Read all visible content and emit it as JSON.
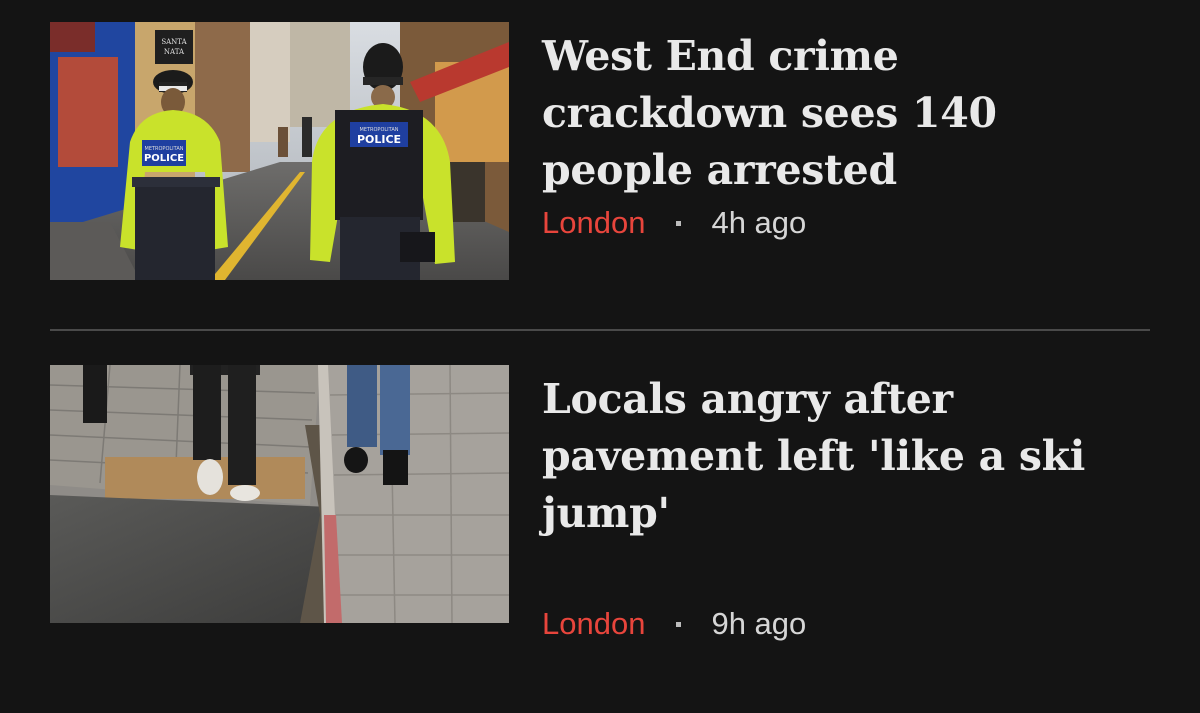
{
  "feed": {
    "stories": [
      {
        "headline": "West End crime crackdown sees 140 people arrested",
        "topic": "London",
        "time": "4h ago",
        "image_text": {
          "shop_sign_line1": "SANTA",
          "shop_sign_line2": "NATA",
          "vest_line1": "METROPOLITAN",
          "vest_line2": "POLICE"
        }
      },
      {
        "headline": "Locals angry after pavement left 'like a ski jump'",
        "topic": "London",
        "time": "9h ago"
      }
    ]
  },
  "colors": {
    "background": "#141414",
    "headline": "#e9e9e9",
    "topic": "#e8453c",
    "timestamp": "#d6d6d6",
    "divider": "#4a4a4a"
  }
}
